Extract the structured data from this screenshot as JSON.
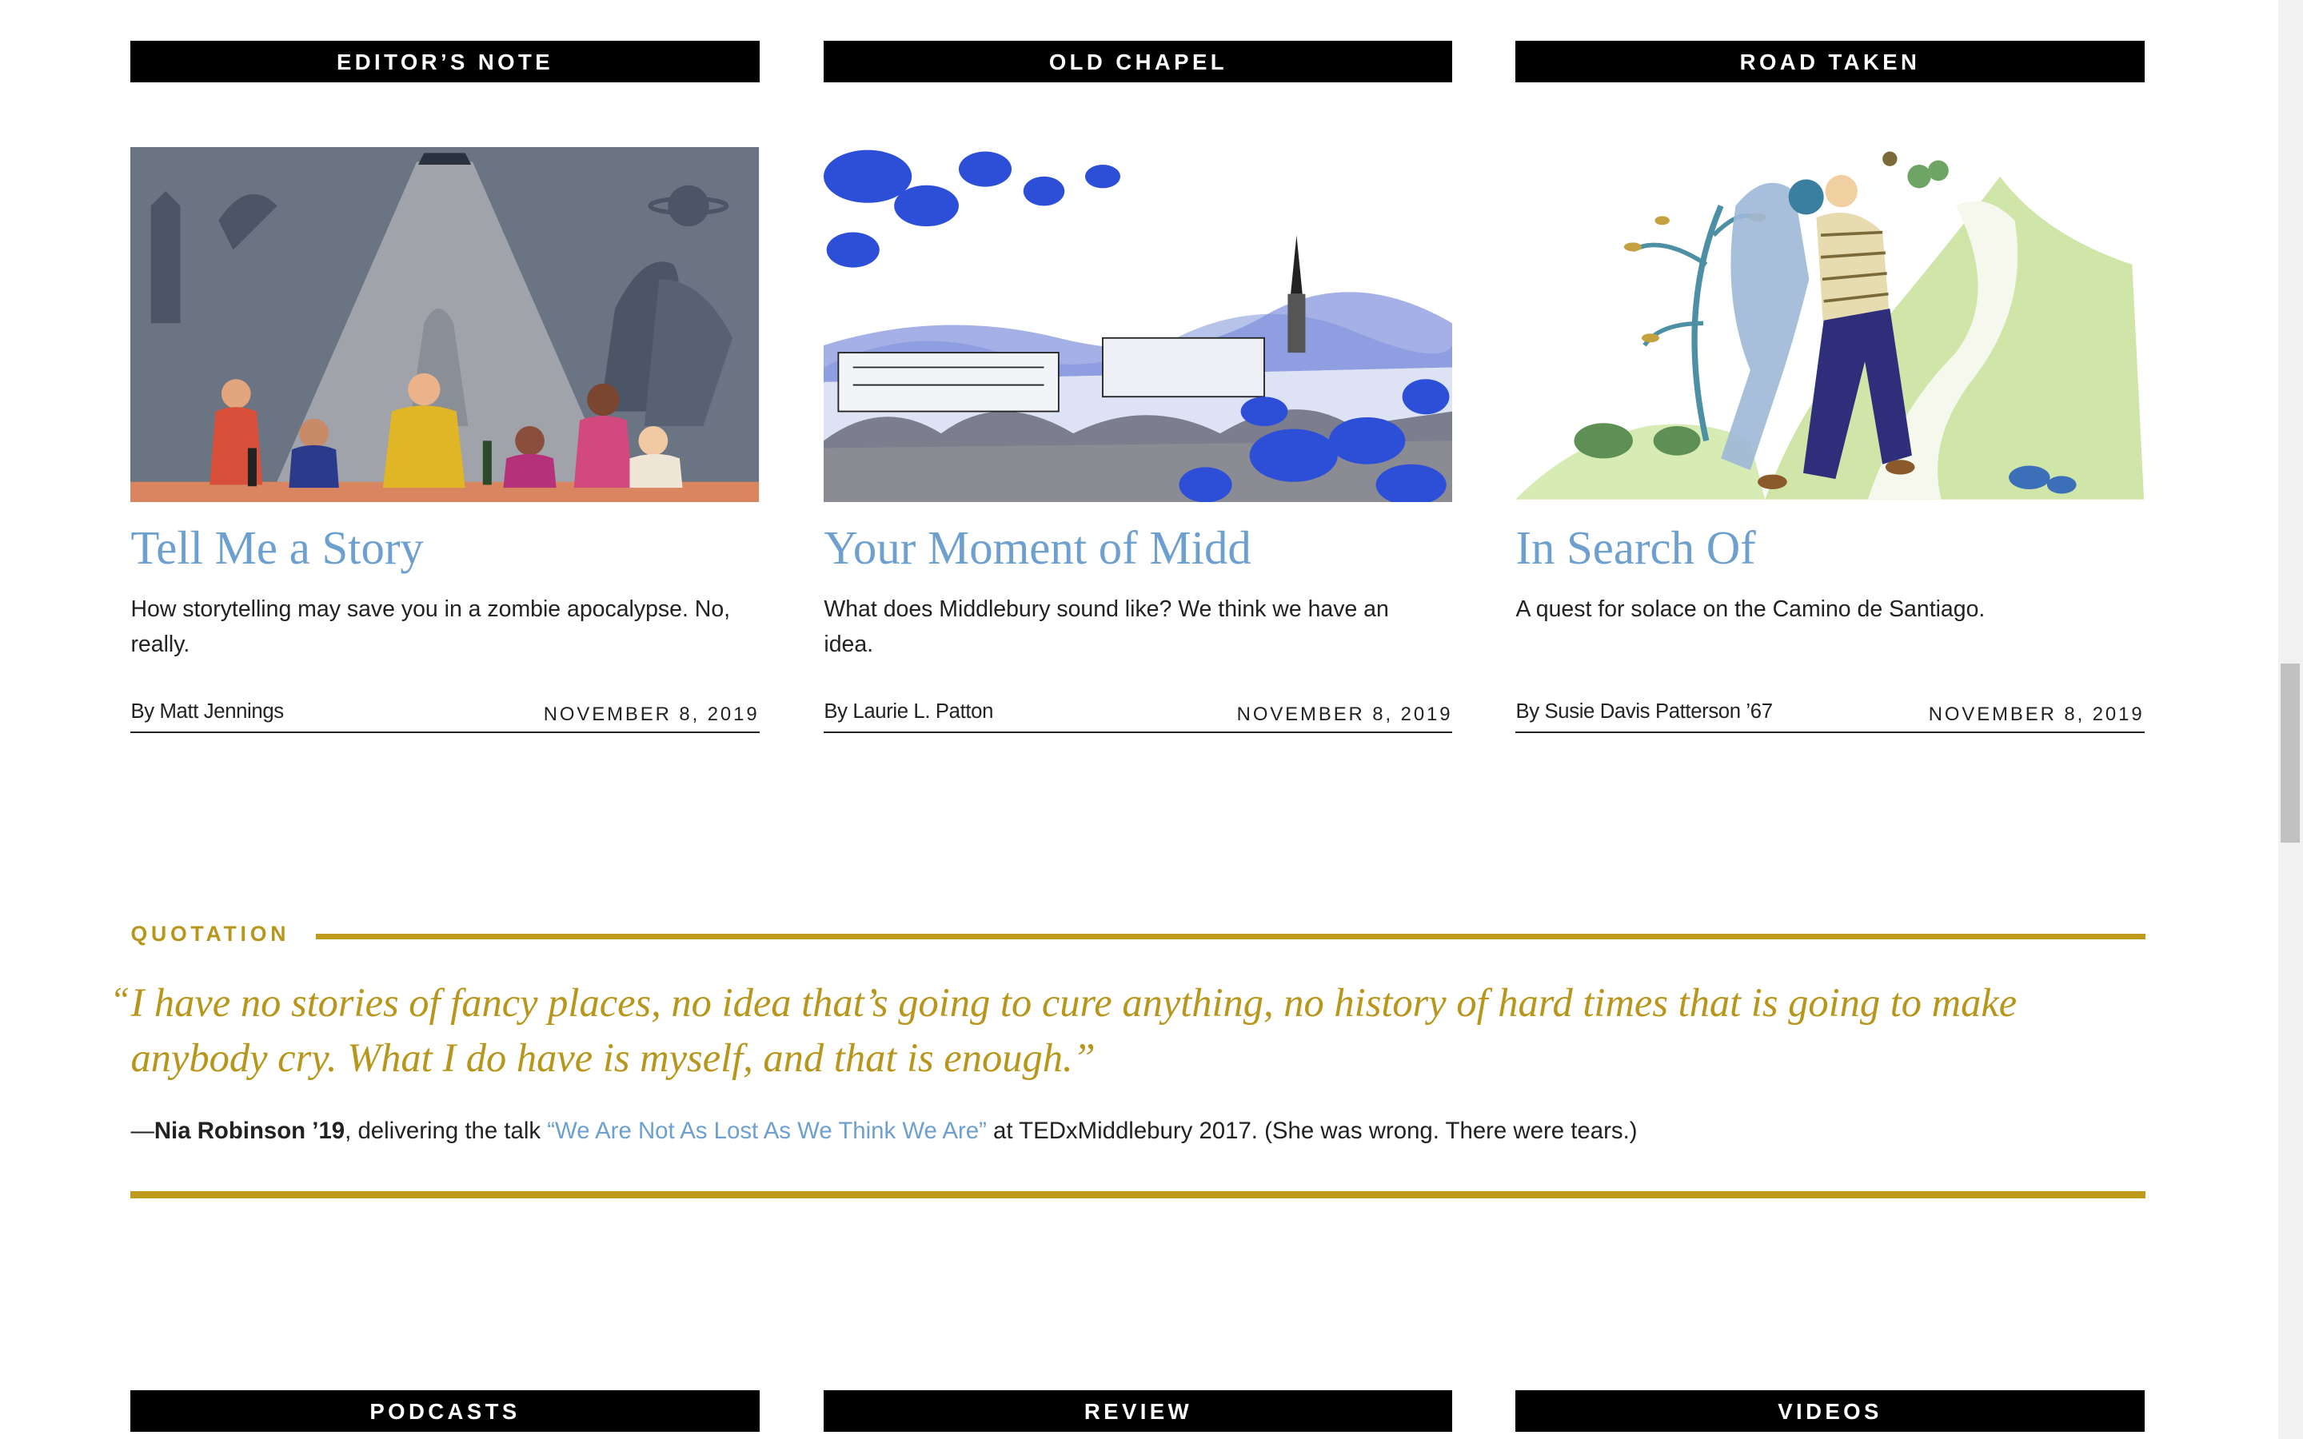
{
  "cards": [
    {
      "section": "EDITOR’S NOTE",
      "title": "Tell Me a Story",
      "dek": "How storytelling may save you in a zombie apocalypse. No, really.",
      "byline": "By Matt Jennings",
      "date": "NOVEMBER 8, 2019"
    },
    {
      "section": "OLD CHAPEL",
      "title": "Your Moment of Midd",
      "dek": "What does Middlebury sound like? We think we have an idea.",
      "byline": "By Laurie L. Patton",
      "date": "NOVEMBER 8, 2019"
    },
    {
      "section": "ROAD TAKEN",
      "title": "In Search Of",
      "dek": "A quest for solace on the Camino de Santiago.",
      "byline": "By Susie Davis Patterson ’67",
      "date": "NOVEMBER 8, 2019"
    }
  ],
  "quotation": {
    "label": "QUOTATION",
    "open_mark": "“",
    "text": "I have no stories of fancy places, no idea that’s going to cure anything, no history of hard times that is going to make anybody cry. What I do have is myself, and that is enough.”",
    "dash": "—",
    "speaker": "Nia Robinson ’19",
    "mid": ", delivering the talk ",
    "talk": "“We Are Not As Lost As We Think We Are”",
    "tail": " at TEDxMiddlebury 2017. (She was wrong. There were tears.)"
  },
  "bottom_sections": [
    "PODCASTS",
    "REVIEW",
    "VIDEOS"
  ],
  "colors": {
    "link_blue": "#6d9fcf",
    "gold": "#b8961c",
    "bar_black": "#000000"
  }
}
